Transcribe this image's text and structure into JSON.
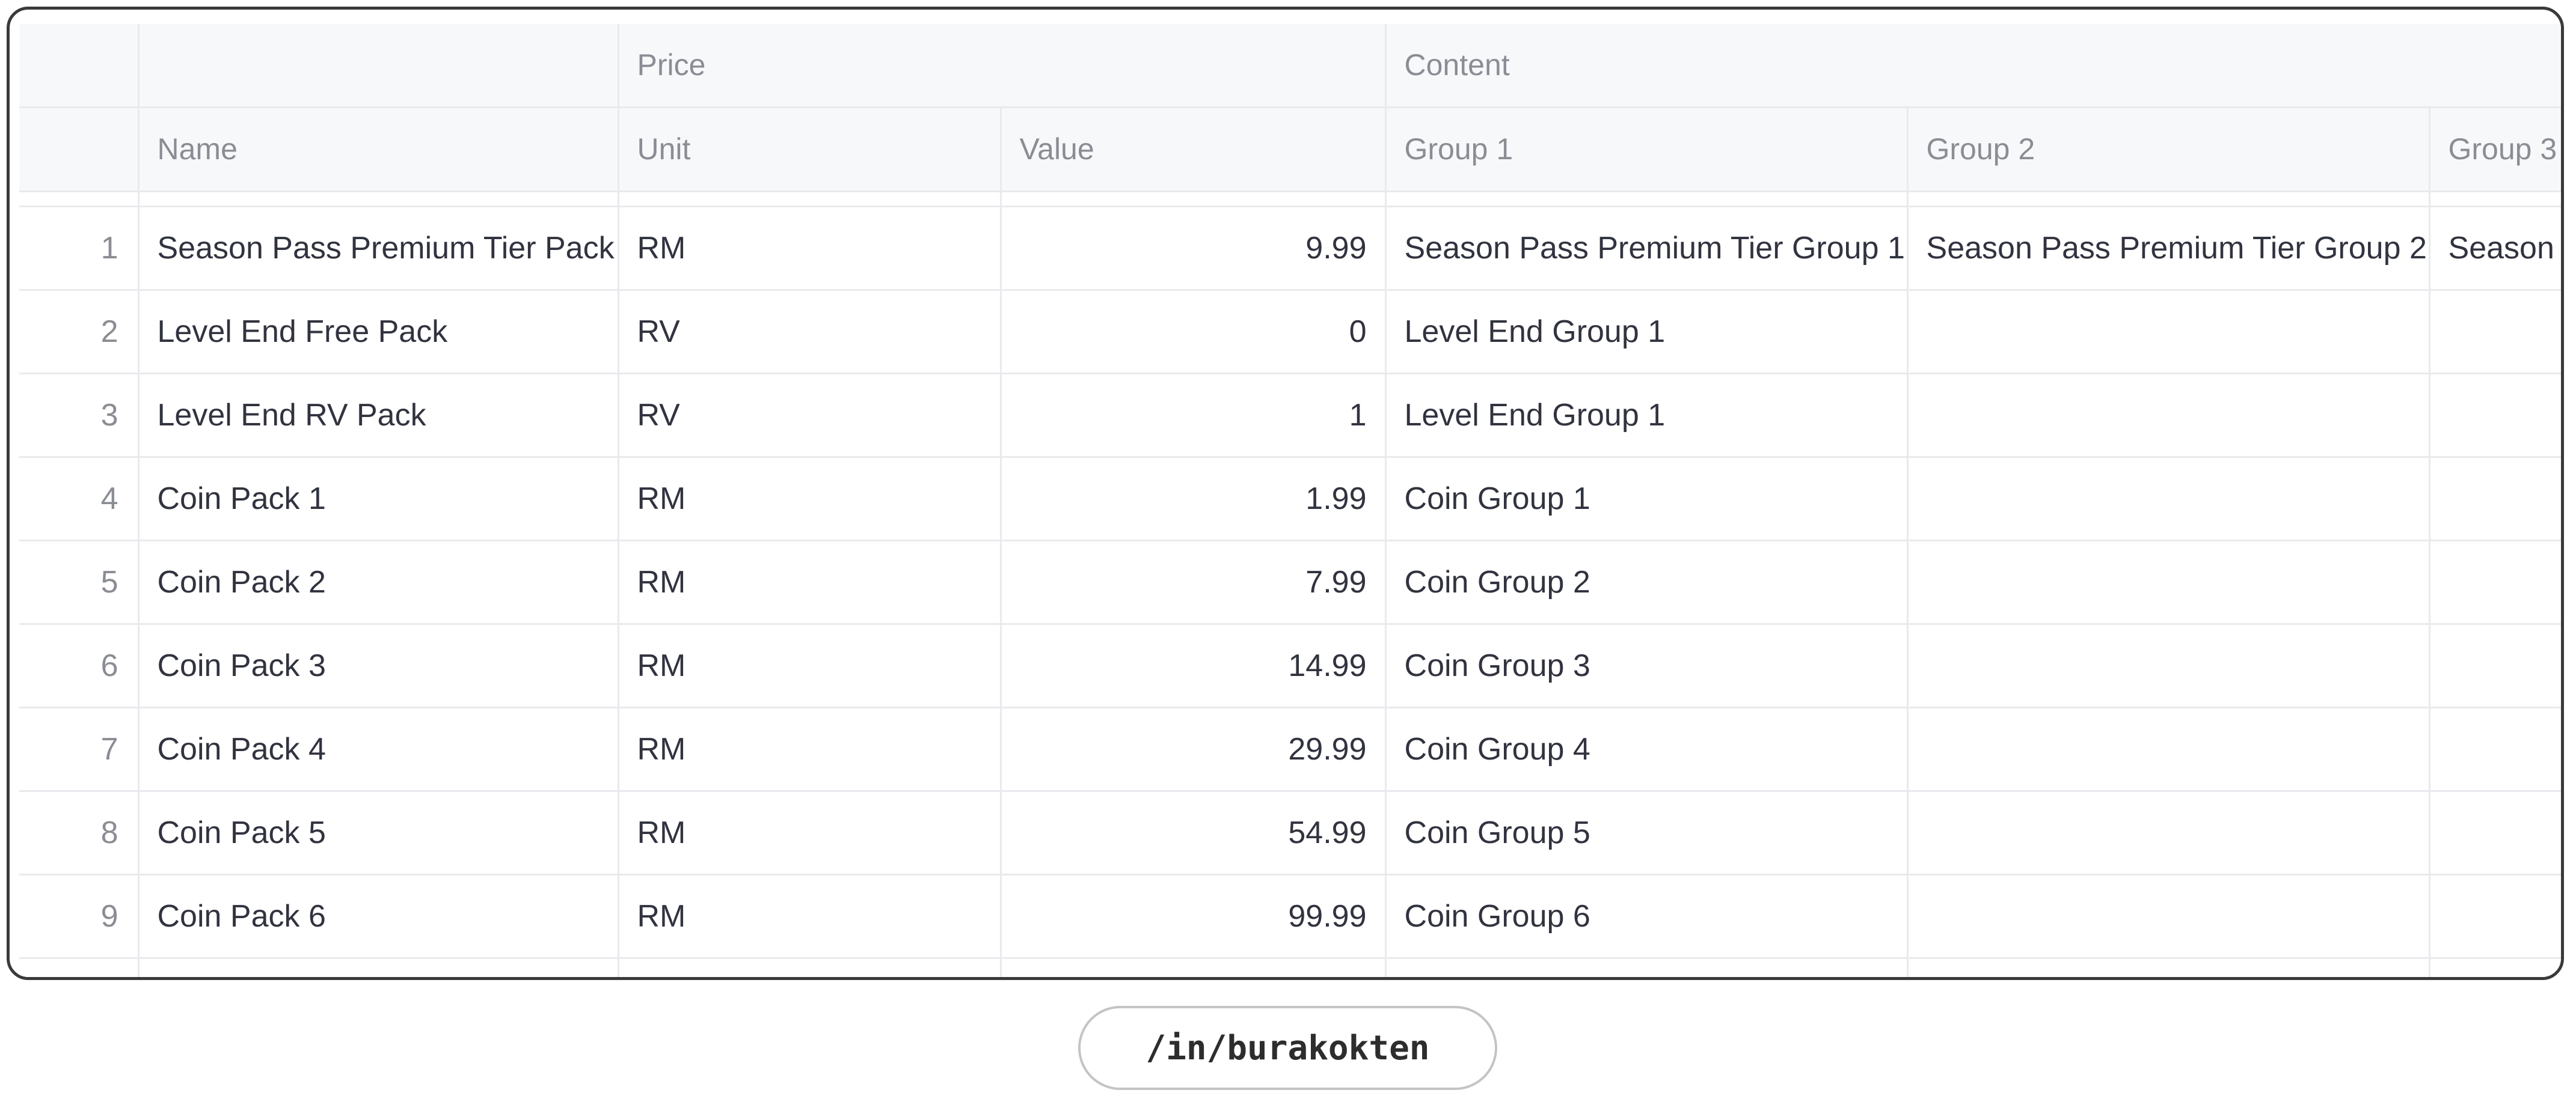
{
  "table": {
    "group_headers": {
      "price": "Price",
      "content": "Content"
    },
    "columns": {
      "name": "Name",
      "unit": "Unit",
      "value": "Value",
      "group1": "Group 1",
      "group2": "Group 2",
      "group3": "Group 3"
    },
    "rows": [
      {
        "index": "1",
        "name": "Season Pass Premium Tier Pack",
        "unit": "RM",
        "value": "9.99",
        "group1": "Season Pass Premium Tier Group 1",
        "group2": "Season Pass Premium Tier Group 2",
        "group3": "Season"
      },
      {
        "index": "2",
        "name": "Level End Free Pack",
        "unit": "RV",
        "value": "0",
        "group1": "Level End Group 1",
        "group2": "",
        "group3": ""
      },
      {
        "index": "3",
        "name": "Level End RV Pack",
        "unit": "RV",
        "value": "1",
        "group1": "Level End Group 1",
        "group2": "",
        "group3": ""
      },
      {
        "index": "4",
        "name": "Coin Pack 1",
        "unit": "RM",
        "value": "1.99",
        "group1": "Coin Group 1",
        "group2": "",
        "group3": ""
      },
      {
        "index": "5",
        "name": "Coin Pack 2",
        "unit": "RM",
        "value": "7.99",
        "group1": "Coin Group 2",
        "group2": "",
        "group3": ""
      },
      {
        "index": "6",
        "name": "Coin Pack 3",
        "unit": "RM",
        "value": "14.99",
        "group1": "Coin Group 3",
        "group2": "",
        "group3": ""
      },
      {
        "index": "7",
        "name": "Coin Pack 4",
        "unit": "RM",
        "value": "29.99",
        "group1": "Coin Group 4",
        "group2": "",
        "group3": ""
      },
      {
        "index": "8",
        "name": "Coin Pack 5",
        "unit": "RM",
        "value": "54.99",
        "group1": "Coin Group 5",
        "group2": "",
        "group3": ""
      },
      {
        "index": "9",
        "name": "Coin Pack 6",
        "unit": "RM",
        "value": "99.99",
        "group1": "Coin Group 6",
        "group2": "",
        "group3": ""
      }
    ]
  },
  "footer": {
    "handle": "/in/burakokten"
  }
}
